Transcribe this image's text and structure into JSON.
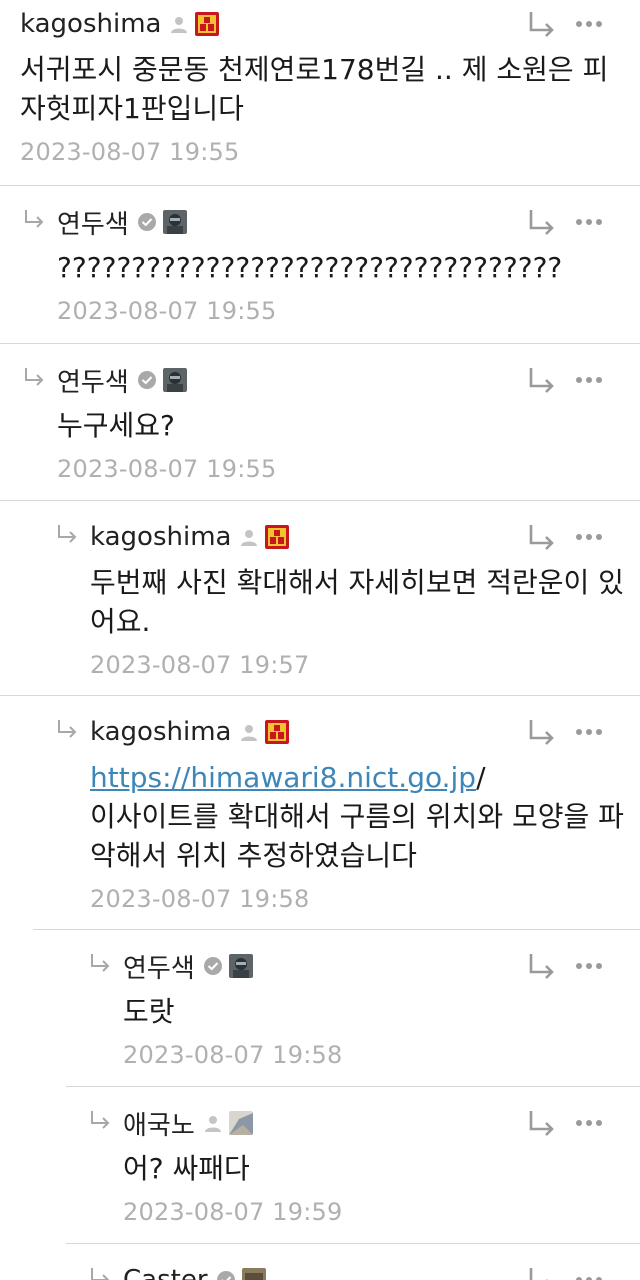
{
  "comments": [
    {
      "author": "kagoshima",
      "author_type": "user-icon",
      "avatar": "kagoshima-avatar",
      "text": "서귀포시 중문동 천제연로178번길 .. 제 소원은 피자헛피자1판입니다",
      "time": "2023-08-07 19:55"
    },
    {
      "author": "연두색",
      "author_type": "verified-icon",
      "avatar": "photo-avatar",
      "text": "??????????????????????????????????",
      "time": "2023-08-07 19:55"
    },
    {
      "author": "연두색",
      "author_type": "verified-icon",
      "avatar": "photo-avatar",
      "text": "누구세요?",
      "time": "2023-08-07 19:55"
    },
    {
      "author": "kagoshima",
      "author_type": "user-icon",
      "avatar": "kagoshima-avatar",
      "text": "두번째 사진 확대해서 자세히보면 적란운이 있어요.",
      "time": "2023-08-07 19:57"
    },
    {
      "author": "kagoshima",
      "author_type": "user-icon",
      "avatar": "kagoshima-avatar",
      "link": "https://himawari8.nict.go.jp",
      "link_suffix": "/",
      "text": "이사이트를 확대해서 구름의 위치와 모양을 파악해서 위치 추정하였습니다",
      "time": "2023-08-07 19:58"
    },
    {
      "author": "연두색",
      "author_type": "verified-icon",
      "avatar": "photo-avatar",
      "text": "도랏",
      "time": "2023-08-07 19:58"
    },
    {
      "author": "애국노",
      "author_type": "user-icon",
      "avatar": "photo-avatar",
      "text": "어? 싸패다",
      "time": "2023-08-07 19:59"
    },
    {
      "author": "Caster",
      "author_type": "verified-icon",
      "avatar": "photo-avatar"
    }
  ],
  "colors": {
    "link": "#3d86b8",
    "timestamp": "#b0b0b0",
    "divider": "#d7d7d7",
    "kagoshima_avatar_bg": "#c8161d",
    "kagoshima_avatar_fg": "#f2c230"
  }
}
